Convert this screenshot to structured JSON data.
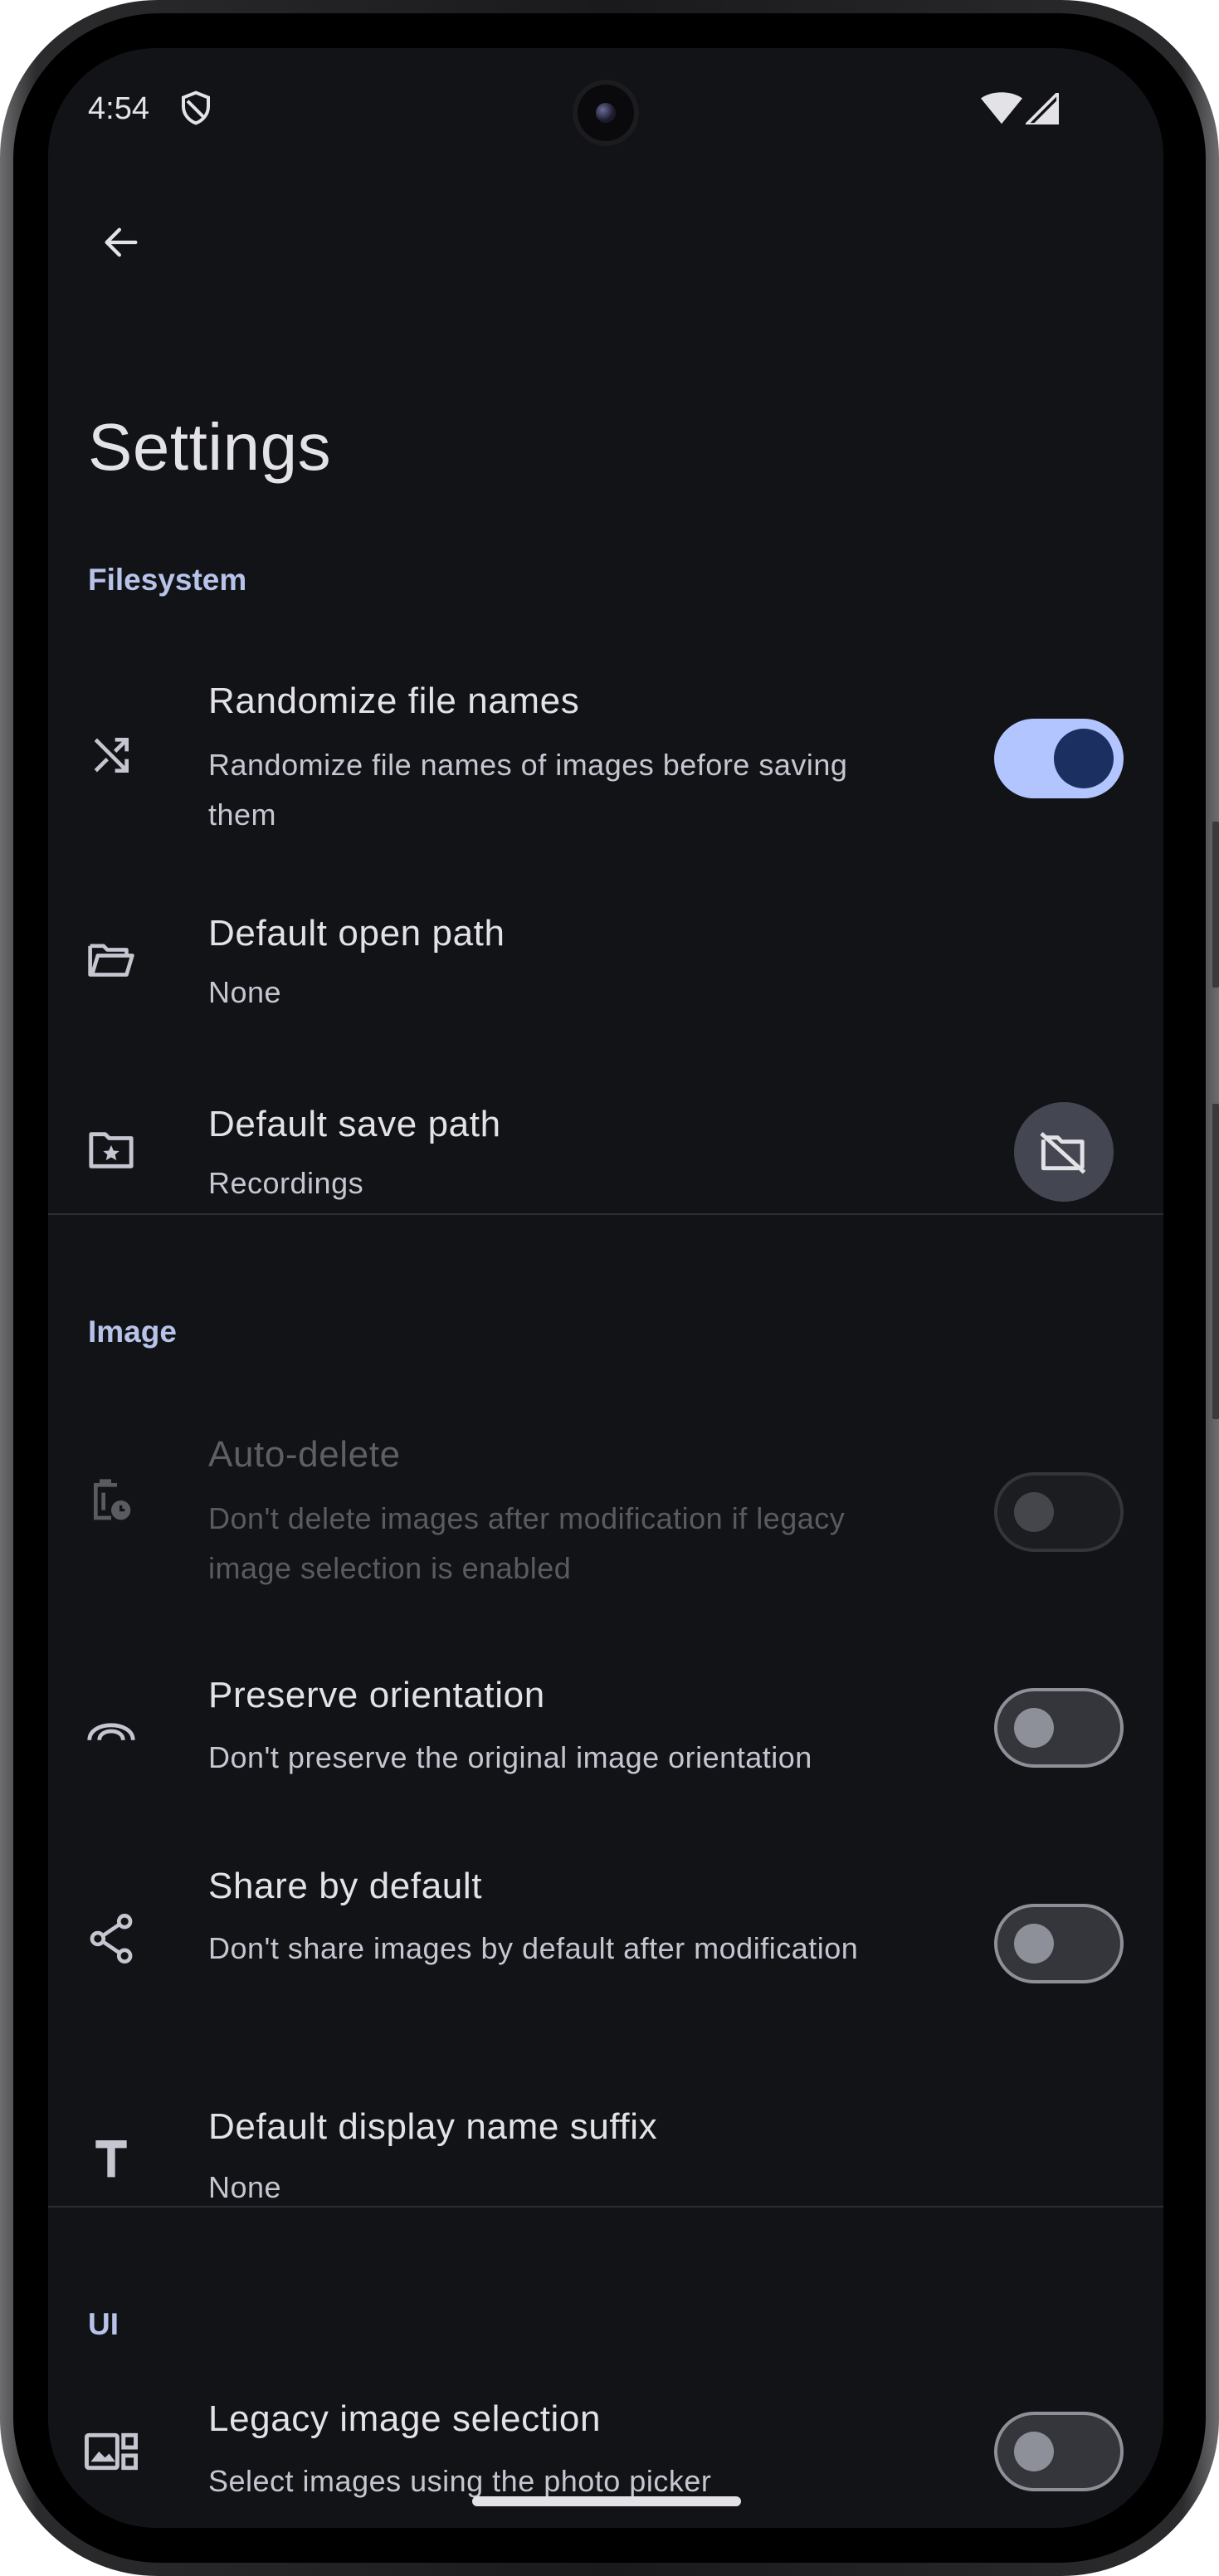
{
  "status_bar": {
    "time": "4:54"
  },
  "header": {
    "title": "Settings"
  },
  "sections": {
    "filesystem": {
      "title": "Filesystem",
      "randomize": {
        "title": "Randomize file names",
        "subtitle": "Randomize file names of images before saving them",
        "enabled": true
      },
      "open_path": {
        "title": "Default open path",
        "subtitle": "None"
      },
      "save_path": {
        "title": "Default save path",
        "subtitle": "Recordings"
      }
    },
    "image": {
      "title": "Image",
      "auto_delete": {
        "title": "Auto-delete",
        "subtitle": "Don't delete images after modification if legacy image selection is enabled",
        "enabled": false,
        "disabled": true
      },
      "preserve_orientation": {
        "title": "Preserve orientation",
        "subtitle": "Don't preserve the original image orientation",
        "enabled": false
      },
      "share_default": {
        "title": "Share by default",
        "subtitle": "Don't share images by default after modification",
        "enabled": false
      },
      "suffix": {
        "title": "Default display name suffix",
        "subtitle": "None"
      }
    },
    "ui": {
      "title": "UI",
      "legacy_selection": {
        "title": "Legacy image selection",
        "subtitle": "Select images using the photo picker",
        "enabled": false
      }
    }
  },
  "colors": {
    "background": "#121317",
    "accent": "#b2c5ff",
    "section_header": "#b8c3ea"
  }
}
